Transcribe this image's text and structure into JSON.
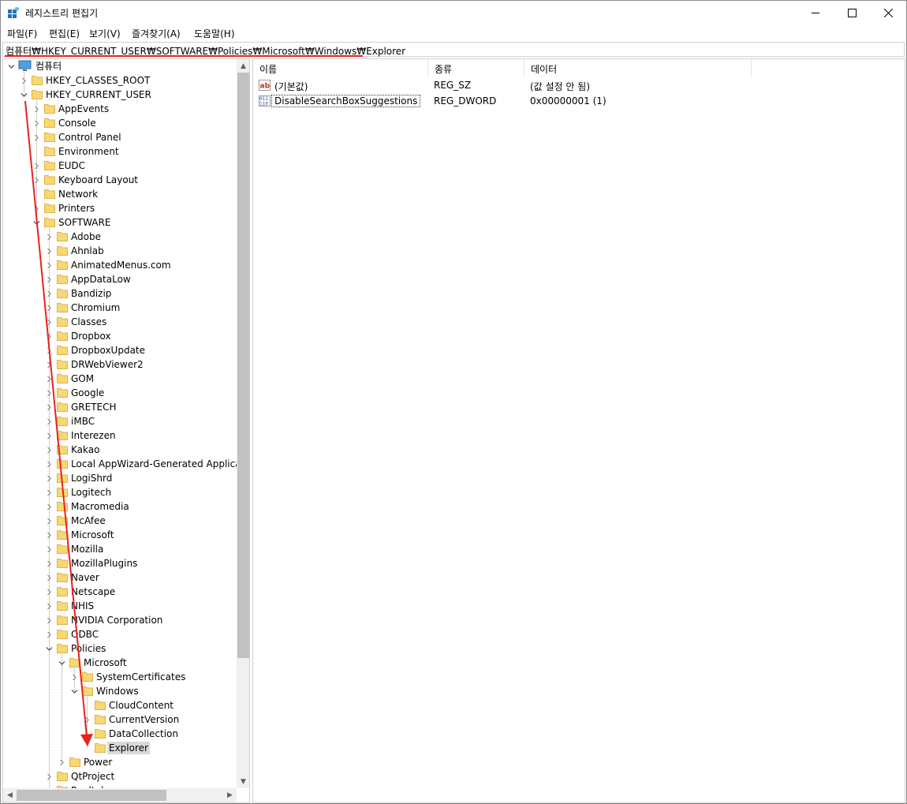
{
  "window": {
    "title": "레지스트리 편집기",
    "controls": {
      "minimize": "minimize",
      "maximize": "maximize",
      "close": "close"
    }
  },
  "menu": [
    "파일(F)",
    "편집(E)",
    "보기(V)",
    "즐겨찾기(A)",
    "도움말(H)"
  ],
  "address": {
    "path": "컴퓨터₩HKEY_CURRENT_USER₩SOFTWARE₩Policies₩Microsoft₩Windows₩Explorer"
  },
  "tree": {
    "root": "컴퓨터",
    "nodes": [
      {
        "label": "HKEY_CLASSES_ROOT",
        "level": 1,
        "toggle": "collapsed"
      },
      {
        "label": "HKEY_CURRENT_USER",
        "level": 1,
        "toggle": "expanded"
      },
      {
        "label": "AppEvents",
        "level": 2,
        "toggle": "collapsed"
      },
      {
        "label": "Console",
        "level": 2,
        "toggle": "collapsed"
      },
      {
        "label": "Control Panel",
        "level": 2,
        "toggle": "collapsed"
      },
      {
        "label": "Environment",
        "level": 2,
        "toggle": "none"
      },
      {
        "label": "EUDC",
        "level": 2,
        "toggle": "collapsed"
      },
      {
        "label": "Keyboard Layout",
        "level": 2,
        "toggle": "collapsed"
      },
      {
        "label": "Network",
        "level": 2,
        "toggle": "none"
      },
      {
        "label": "Printers",
        "level": 2,
        "toggle": "collapsed"
      },
      {
        "label": "SOFTWARE",
        "level": 2,
        "toggle": "expanded"
      },
      {
        "label": "Adobe",
        "level": 3,
        "toggle": "collapsed"
      },
      {
        "label": "Ahnlab",
        "level": 3,
        "toggle": "collapsed"
      },
      {
        "label": "AnimatedMenus.com",
        "level": 3,
        "toggle": "collapsed"
      },
      {
        "label": "AppDataLow",
        "level": 3,
        "toggle": "collapsed"
      },
      {
        "label": "Bandizip",
        "level": 3,
        "toggle": "collapsed"
      },
      {
        "label": "Chromium",
        "level": 3,
        "toggle": "collapsed"
      },
      {
        "label": "Classes",
        "level": 3,
        "toggle": "collapsed"
      },
      {
        "label": "Dropbox",
        "level": 3,
        "toggle": "collapsed"
      },
      {
        "label": "DropboxUpdate",
        "level": 3,
        "toggle": "collapsed"
      },
      {
        "label": "DRWebViewer2",
        "level": 3,
        "toggle": "collapsed"
      },
      {
        "label": "GOM",
        "level": 3,
        "toggle": "collapsed"
      },
      {
        "label": "Google",
        "level": 3,
        "toggle": "collapsed"
      },
      {
        "label": "GRETECH",
        "level": 3,
        "toggle": "collapsed"
      },
      {
        "label": "iMBC",
        "level": 3,
        "toggle": "collapsed"
      },
      {
        "label": "Interezen",
        "level": 3,
        "toggle": "collapsed"
      },
      {
        "label": "Kakao",
        "level": 3,
        "toggle": "collapsed"
      },
      {
        "label": "Local AppWizard-Generated Applicatic",
        "level": 3,
        "toggle": "collapsed"
      },
      {
        "label": "LogiShrd",
        "level": 3,
        "toggle": "collapsed"
      },
      {
        "label": "Logitech",
        "level": 3,
        "toggle": "collapsed"
      },
      {
        "label": "Macromedia",
        "level": 3,
        "toggle": "collapsed"
      },
      {
        "label": "McAfee",
        "level": 3,
        "toggle": "collapsed"
      },
      {
        "label": "Microsoft",
        "level": 3,
        "toggle": "collapsed"
      },
      {
        "label": "Mozilla",
        "level": 3,
        "toggle": "collapsed"
      },
      {
        "label": "MozillaPlugins",
        "level": 3,
        "toggle": "collapsed"
      },
      {
        "label": "Naver",
        "level": 3,
        "toggle": "collapsed"
      },
      {
        "label": "Netscape",
        "level": 3,
        "toggle": "collapsed"
      },
      {
        "label": "NHIS",
        "level": 3,
        "toggle": "collapsed"
      },
      {
        "label": "NVIDIA Corporation",
        "level": 3,
        "toggle": "collapsed"
      },
      {
        "label": "ODBC",
        "level": 3,
        "toggle": "collapsed"
      },
      {
        "label": "Policies",
        "level": 3,
        "toggle": "expanded"
      },
      {
        "label": "Microsoft",
        "level": 4,
        "toggle": "expanded"
      },
      {
        "label": "SystemCertificates",
        "level": 5,
        "toggle": "collapsed"
      },
      {
        "label": "Windows",
        "level": 5,
        "toggle": "expanded"
      },
      {
        "label": "CloudContent",
        "level": 6,
        "toggle": "none"
      },
      {
        "label": "CurrentVersion",
        "level": 6,
        "toggle": "collapsed"
      },
      {
        "label": "DataCollection",
        "level": 6,
        "toggle": "none"
      },
      {
        "label": "Explorer",
        "level": 6,
        "toggle": "none",
        "selected": true
      },
      {
        "label": "Power",
        "level": 4,
        "toggle": "collapsed"
      },
      {
        "label": "QtProject",
        "level": 3,
        "toggle": "collapsed"
      },
      {
        "label": "Realtek",
        "level": 3,
        "toggle": "collapsed"
      }
    ]
  },
  "list": {
    "columns": [
      "이름",
      "종류",
      "데이터"
    ],
    "rows": [
      {
        "icon": "string-value-icon",
        "name": "(기본값)",
        "type": "REG_SZ",
        "data": "(값 설정 안 됨)"
      },
      {
        "icon": "dword-value-icon",
        "name": "DisableSearchBoxSuggestions",
        "type": "REG_DWORD",
        "data": "0x00000001 (1)",
        "focused": true
      }
    ]
  },
  "colors": {
    "annotation": "#e8231f",
    "folder": "#f8d775",
    "folder_dark": "#e0b34a",
    "selection": "#d9d9d9"
  }
}
